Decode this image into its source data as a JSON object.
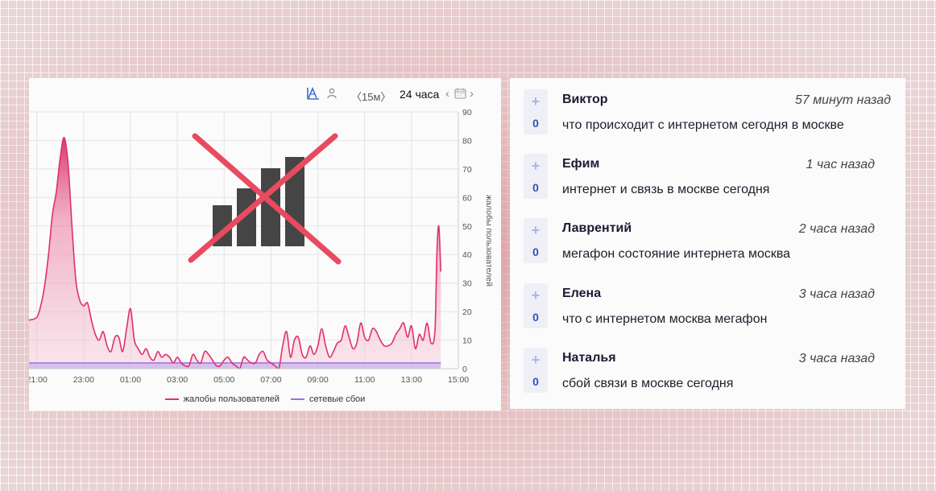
{
  "toolbar": {
    "interval": "〈15м〉",
    "range": "24 часа",
    "icons": [
      "chart-type-icon",
      "user-icon",
      "calendar-icon"
    ]
  },
  "chart_data": {
    "type": "area",
    "x_ticks": [
      "21:00",
      "23:00",
      "01:00",
      "03:00",
      "05:00",
      "07:00",
      "09:00",
      "11:00",
      "13:00",
      "15:00"
    ],
    "y_ticks": [
      "0",
      "10",
      "20",
      "30",
      "40",
      "50",
      "60",
      "70",
      "80",
      "90"
    ],
    "ylim": [
      0,
      90
    ],
    "xlim": [
      "20:40",
      "15:00"
    ],
    "ylabel": "жалобы пользователей",
    "grid": true,
    "legend_position": "bottom",
    "series": [
      {
        "name": "жалобы пользователей",
        "color": "#e0306a",
        "x": [
          "20:40",
          "21:00",
          "21:10",
          "21:20",
          "21:30",
          "21:40",
          "21:50",
          "22:00",
          "22:10",
          "22:20",
          "22:30",
          "22:40",
          "22:50",
          "23:00",
          "23:10",
          "23:20",
          "23:30",
          "23:40",
          "23:50",
          "00:00",
          "00:10",
          "00:20",
          "00:30",
          "00:40",
          "00:50",
          "01:00",
          "01:10",
          "01:20",
          "01:30",
          "01:40",
          "01:50",
          "02:00",
          "02:10",
          "02:20",
          "02:30",
          "02:40",
          "02:50",
          "03:00",
          "03:10",
          "03:20",
          "03:30",
          "03:40",
          "03:50",
          "04:00",
          "04:10",
          "04:20",
          "04:30",
          "04:40",
          "04:50",
          "05:00",
          "05:10",
          "05:20",
          "05:30",
          "05:40",
          "05:50",
          "06:00",
          "06:10",
          "06:20",
          "06:30",
          "06:40",
          "06:50",
          "07:00",
          "07:10",
          "07:20",
          "07:30",
          "07:40",
          "07:50",
          "08:00",
          "08:10",
          "08:20",
          "08:30",
          "08:40",
          "08:50",
          "09:00",
          "09:10",
          "09:20",
          "09:30",
          "09:40",
          "09:50",
          "10:00",
          "10:10",
          "10:20",
          "10:30",
          "10:40",
          "10:50",
          "11:00",
          "11:10",
          "11:20",
          "11:30",
          "11:40",
          "11:50",
          "12:00",
          "12:10",
          "12:20",
          "12:30",
          "12:40",
          "12:50",
          "13:00",
          "13:10",
          "13:20",
          "13:30",
          "13:40",
          "13:50",
          "14:00",
          "14:05",
          "14:10",
          "14:15"
        ],
        "values": [
          17,
          18,
          22,
          29,
          40,
          54,
          62,
          74,
          81,
          72,
          50,
          31,
          24,
          22,
          23,
          17,
          12,
          10,
          13,
          8,
          6,
          11,
          11,
          6,
          14,
          21,
          10,
          7,
          5,
          7,
          4,
          3,
          6,
          4,
          5,
          4,
          2,
          4,
          2,
          1,
          1,
          5,
          3,
          2,
          6,
          5,
          3,
          1,
          1,
          3,
          4,
          2,
          1,
          0,
          4,
          3,
          2,
          2,
          5,
          6,
          3,
          2,
          1,
          0,
          8,
          13,
          4,
          10,
          11,
          5,
          4,
          8,
          5,
          8,
          14,
          8,
          4,
          6,
          9,
          10,
          15,
          11,
          7,
          9,
          16,
          11,
          10,
          14,
          13,
          10,
          8,
          8,
          9,
          12,
          14,
          16,
          11,
          15,
          7,
          12,
          10,
          16,
          9,
          13,
          40,
          50,
          34
        ]
      },
      {
        "name": "сетевые сбои",
        "color": "#9b6fe0",
        "x": [
          "20:40",
          "15:00"
        ],
        "values": [
          2,
          2
        ]
      }
    ]
  },
  "comments": [
    {
      "name": "Виктор",
      "time": "57 минут назад",
      "text": "что происходит с интернетом сегодня в москве",
      "votes": "0"
    },
    {
      "name": "Ефим",
      "time": "1 час назад",
      "text": "интернет и связь в москве сегодня",
      "votes": "0"
    },
    {
      "name": "Лаврентий",
      "time": "2 часа назад",
      "text": "мегафон состояние интернета москва",
      "votes": "0"
    },
    {
      "name": "Елена",
      "time": "3 часа назад",
      "text": "что с интернетом москва мегафон",
      "votes": "0"
    },
    {
      "name": "Наталья",
      "time": "3 часа назад",
      "text": "сбой связи в москве сегодня",
      "votes": "0"
    }
  ],
  "colors": {
    "accent": "#e0306a",
    "secondary": "#9b6fe0",
    "vote_count": "#3c4fb3",
    "cross_out": "#e84a5f"
  }
}
